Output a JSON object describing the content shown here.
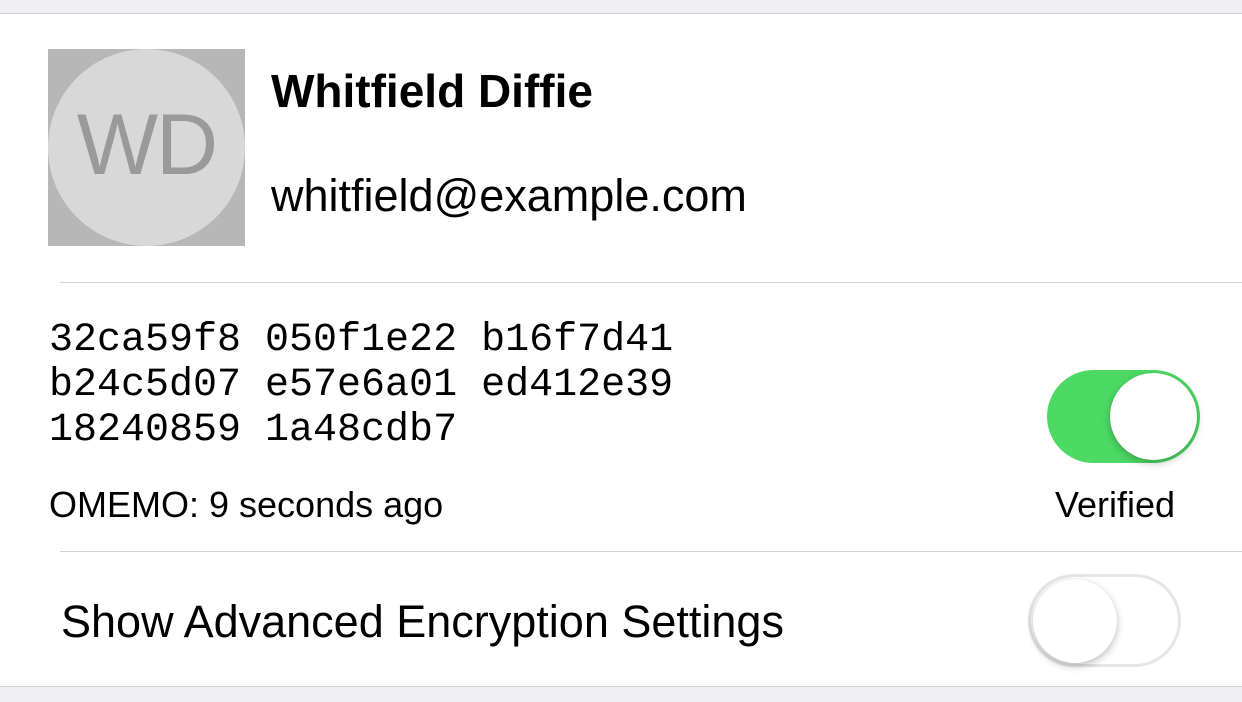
{
  "contact": {
    "initials": "WD",
    "name": "Whitfield Diffie",
    "email": "whitfield@example.com"
  },
  "fingerprint": {
    "lines": [
      "32ca59f8 050f1e22 b16f7d41",
      "b24c5d07 e57e6a01 ed412e39",
      "18240859 1a48cdb7"
    ],
    "last_seen": "OMEMO: 9 seconds ago",
    "verified_label": "Verified",
    "verified": true
  },
  "advanced": {
    "label": "Show Advanced Encryption Settings",
    "enabled": false
  },
  "colors": {
    "toggle_on": "#4cd964",
    "separator": "#d1d1d6",
    "group_background": "#efeff4"
  }
}
